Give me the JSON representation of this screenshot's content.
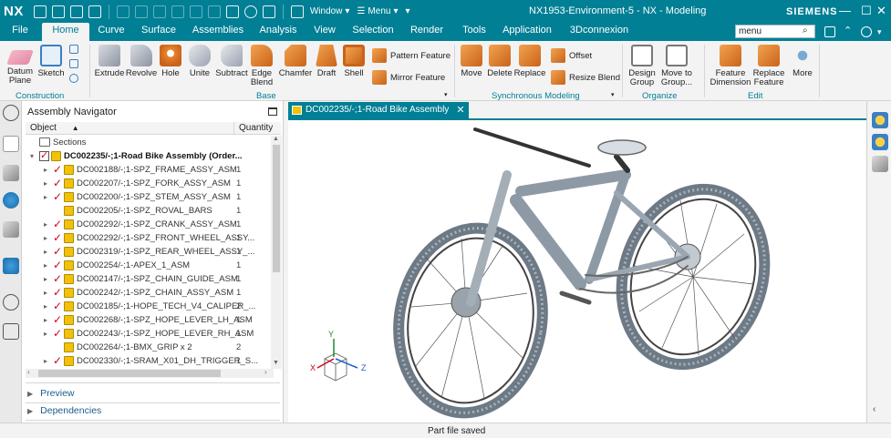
{
  "titlebar": {
    "app_logo": "NX",
    "window_menu": "Window",
    "menu_menu": "Menu",
    "window_title": "NX1953-Environment-5 - NX - Modeling",
    "brand": "SIEMENS"
  },
  "tabs": [
    "File",
    "Home",
    "Curve",
    "Surface",
    "Assemblies",
    "Analysis",
    "View",
    "Selection",
    "Render",
    "Tools",
    "Application",
    "3Dconnexion"
  ],
  "active_tab": "Home",
  "search": {
    "value": "menu"
  },
  "ribbon": {
    "construction": {
      "label": "Construction",
      "datum_plane": "Datum Plane",
      "sketch": "Sketch"
    },
    "base": {
      "label": "Base",
      "buttons": [
        "Extrude",
        "Revolve",
        "Hole",
        "Unite",
        "Subtract",
        "Edge Blend",
        "Chamfer",
        "Draft",
        "Shell"
      ],
      "pattern_feature": "Pattern Feature",
      "mirror_feature": "Mirror Feature"
    },
    "sync": {
      "label": "Synchronous Modeling",
      "buttons": [
        "Move",
        "Delete",
        "Replace"
      ],
      "offset": "Offset",
      "resize_blend": "Resize Blend"
    },
    "organize": {
      "label": "Organize",
      "design_group": "Design Group",
      "move_to_group": "Move to Group..."
    },
    "edit": {
      "label": "Edit",
      "feature_dimension": "Feature Dimension",
      "replace_feature": "Replace Feature",
      "more": "More"
    }
  },
  "navigator": {
    "title": "Assembly Navigator",
    "col_object": "Object",
    "col_quantity": "Quantity",
    "sections": "Sections",
    "root": "DC002235/-;1-Road Bike Assembly (Order...",
    "rows": [
      {
        "name": "DC002188/-;1-SPZ_FRAME_ASSY_ASM",
        "qty": "1",
        "checked": true,
        "expandable": true
      },
      {
        "name": "DC002207/-;1-SPZ_FORK_ASSY_ASM",
        "qty": "1",
        "checked": true,
        "expandable": true
      },
      {
        "name": "DC002200/-;1-SPZ_STEM_ASSY_ASM",
        "qty": "1",
        "checked": true,
        "expandable": true
      },
      {
        "name": "DC002205/-;1-SPZ_ROVAL_BARS",
        "qty": "1",
        "checked": false,
        "expandable": false
      },
      {
        "name": "DC002292/-;1-SPZ_CRANK_ASSY_ASM",
        "qty": "1",
        "checked": true,
        "expandable": true
      },
      {
        "name": "DC002292/-;1-SPZ_FRONT_WHEEL_ASSY...",
        "qty": "1",
        "checked": true,
        "expandable": true
      },
      {
        "name": "DC002319/-;1-SPZ_REAR_WHEEL_ASSY_...",
        "qty": "1",
        "checked": true,
        "expandable": true
      },
      {
        "name": "DC002254/-;1-APEX_1_ASM",
        "qty": "1",
        "checked": true,
        "expandable": true
      },
      {
        "name": "DC002147/-;1-SPZ_CHAIN_GUIDE_ASM",
        "qty": "1",
        "checked": true,
        "expandable": true
      },
      {
        "name": "DC002242/-;1-SPZ_CHAIN_ASSY_ASM",
        "qty": "1",
        "checked": true,
        "expandable": true
      },
      {
        "name": "DC002185/-;1-HOPE_TECH_V4_CALIPER_...",
        "qty": "2",
        "checked": true,
        "expandable": true
      },
      {
        "name": "DC002268/-;1-SPZ_HOPE_LEVER_LH_ASM",
        "qty": "1",
        "checked": true,
        "expandable": true
      },
      {
        "name": "DC002243/-;1-SPZ_HOPE_LEVER_RH_ASM",
        "qty": "1",
        "checked": true,
        "expandable": true
      },
      {
        "name": "DC002264/-;1-BMX_GRIP x 2",
        "qty": "2",
        "checked": false,
        "expandable": false
      },
      {
        "name": "DC002330/-;1-SRAM_X01_DH_TRIGGER_S...",
        "qty": "1",
        "checked": true,
        "expandable": true
      }
    ],
    "preview": "Preview",
    "dependencies": "Dependencies"
  },
  "graphics": {
    "tab_label": "DC002235/-;1-Road Bike Assembly"
  },
  "triad": {
    "x": "X",
    "y": "Y",
    "z": "Z"
  },
  "status": "Part file saved",
  "colors": {
    "accent": "#007f95",
    "check": "#d4001b",
    "part": "#f0c20a"
  }
}
